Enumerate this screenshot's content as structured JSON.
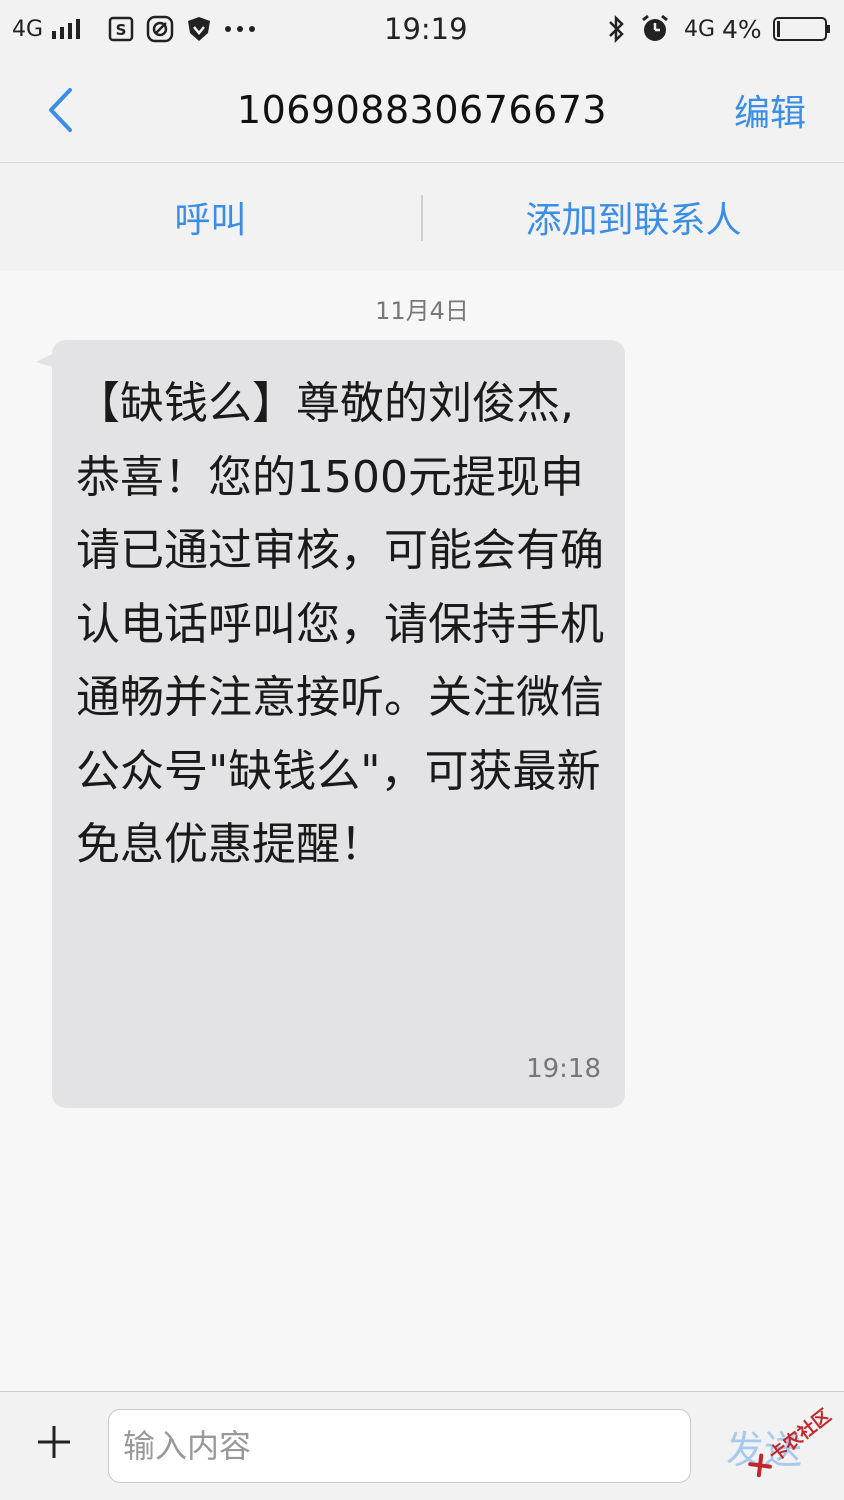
{
  "status_bar": {
    "network_left": "4G",
    "time": "19:19",
    "network_right": "4G",
    "battery_percent": "4%",
    "icons": [
      "signal-icon",
      "sim-card-icon",
      "notification-app-icon",
      "vpn-shield-icon",
      "more-dots-icon",
      "bluetooth-icon",
      "alarm-icon",
      "battery-icon"
    ]
  },
  "header": {
    "title": "106908830676673",
    "edit_label": "编辑",
    "back_icon": "chevron-left-icon"
  },
  "actions": {
    "call_label": "呼叫",
    "add_contact_label": "添加到联系人"
  },
  "conversation": {
    "date": "11月4日",
    "messages": [
      {
        "text": "【缺钱么】尊敬的刘俊杰,恭喜！您的1500元提现申请已通过审核，可能会有确认电话呼叫您，请保持手机通畅并注意接听。关注微信公众号\"缺钱么\"，可获最新免息优惠提醒！",
        "time": "19:18"
      }
    ]
  },
  "composer": {
    "placeholder": "输入内容",
    "value": "",
    "send_label": "发送",
    "plus_icon": "plus-icon"
  },
  "watermark": {
    "text": "卡农社区"
  },
  "colors": {
    "accent": "#3a8ee6",
    "send_disabled": "#a7c9ee",
    "bubble": "#e3e3e6",
    "background": "#f2f2f2"
  }
}
